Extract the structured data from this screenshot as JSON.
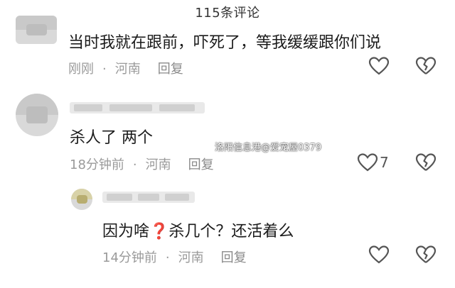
{
  "header": {
    "title": "115条评论"
  },
  "watermark": "洛阳信息港@爱宠屋0379",
  "comments": [
    {
      "text": "当时我就在跟前，吓死了，等我缓缓跟你们说",
      "time": "刚刚",
      "location": "河南",
      "reply_label": "回复",
      "likes": ""
    },
    {
      "text": "杀人了 两个",
      "time": "18分钟前",
      "location": "河南",
      "reply_label": "回复",
      "likes": "7"
    },
    {
      "text_before": "因为啥",
      "emoji": "❓",
      "text_after": "杀几个？还活着么",
      "time": "14分钟前",
      "location": "河南",
      "reply_label": "回复",
      "likes": ""
    }
  ],
  "icons": {
    "like": "heart-outline-icon",
    "dislike": "broken-heart-icon"
  },
  "colors": {
    "text": "#1b1b1b",
    "meta": "#9a9a9a",
    "emoji": "#e02020"
  }
}
